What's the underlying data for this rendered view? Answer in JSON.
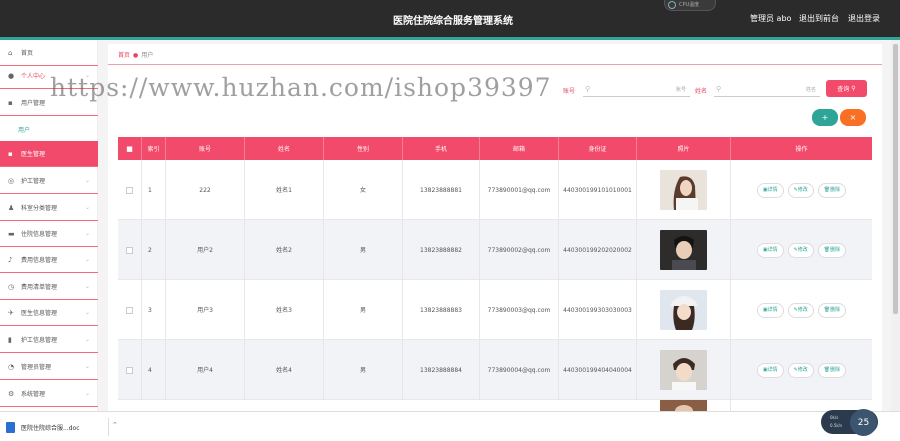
{
  "header": {
    "title": "医院住院综合服务管理系统",
    "admin": "管理员 abo",
    "front": "退出到前台",
    "logout": "退出登录",
    "badge": "CPU温度"
  },
  "sidebar": {
    "items": [
      {
        "label": "首页",
        "icon": "home-icon"
      },
      {
        "label": "个人中心",
        "icon": "user-icon"
      },
      {
        "label": "用户管理",
        "icon": "users-icon"
      },
      {
        "label": "用户",
        "icon": ""
      },
      {
        "label": "医生管理",
        "icon": "doctor-icon"
      },
      {
        "label": "护工管理",
        "icon": "nurse-icon"
      },
      {
        "label": "科室分类管理",
        "icon": "department-icon"
      },
      {
        "label": "住院信息管理",
        "icon": "inpatient-icon"
      },
      {
        "label": "费用信息管理",
        "icon": "fee-icon"
      },
      {
        "label": "费用清单管理",
        "icon": "bill-icon"
      },
      {
        "label": "医生信息管理",
        "icon": "doctor-info-icon"
      },
      {
        "label": "护工信息管理",
        "icon": "nurse-info-icon"
      },
      {
        "label": "管理员管理",
        "icon": "admin-icon"
      },
      {
        "label": "系统管理",
        "icon": "settings-icon"
      }
    ]
  },
  "breadcrumb": {
    "home": "首页",
    "current": "用户"
  },
  "search": {
    "account_label": "账号",
    "account_placeholder": "账号",
    "name_label": "姓名",
    "name_placeholder": "姓名",
    "query_button": "查询"
  },
  "toolbar": {
    "add": "+",
    "delete": "×"
  },
  "table": {
    "columns": [
      "索引",
      "账号",
      "姓名",
      "性别",
      "手机",
      "邮箱",
      "身份证",
      "照片",
      "操作"
    ],
    "rows": [
      {
        "index": "1",
        "account": "222",
        "name": "姓名1",
        "gender": "女",
        "phone": "13823888881",
        "email": "773890001@qq.com",
        "idcard": "440300199101010001",
        "photo": "photo-woman-1"
      },
      {
        "index": "2",
        "account": "用户2",
        "name": "姓名2",
        "gender": "男",
        "phone": "13823888882",
        "email": "773890002@qq.com",
        "idcard": "440300199202020002",
        "photo": "photo-man-2"
      },
      {
        "index": "3",
        "account": "用户3",
        "name": "姓名3",
        "gender": "男",
        "phone": "13823888883",
        "email": "773890003@qq.com",
        "idcard": "440300199303030003",
        "photo": "photo-woman-3"
      },
      {
        "index": "4",
        "account": "用户4",
        "name": "姓名4",
        "gender": "男",
        "phone": "13823888884",
        "email": "773890004@qq.com",
        "idcard": "440300199404040004",
        "photo": "photo-man-4"
      }
    ],
    "actions": {
      "view": "详情",
      "edit": "修改",
      "delete": "删除"
    }
  },
  "watermark": "https://www.huzhan.com/ishop39397",
  "download": {
    "filename": "医院住院综合服...doc"
  },
  "perf": {
    "value": "25",
    "line1": "0k/s",
    "line2": "0.5k/s"
  },
  "colors": {
    "accent": "#f24a6b",
    "teal": "#2ea597",
    "orange": "#f97024",
    "header": "#2b2b2b"
  }
}
